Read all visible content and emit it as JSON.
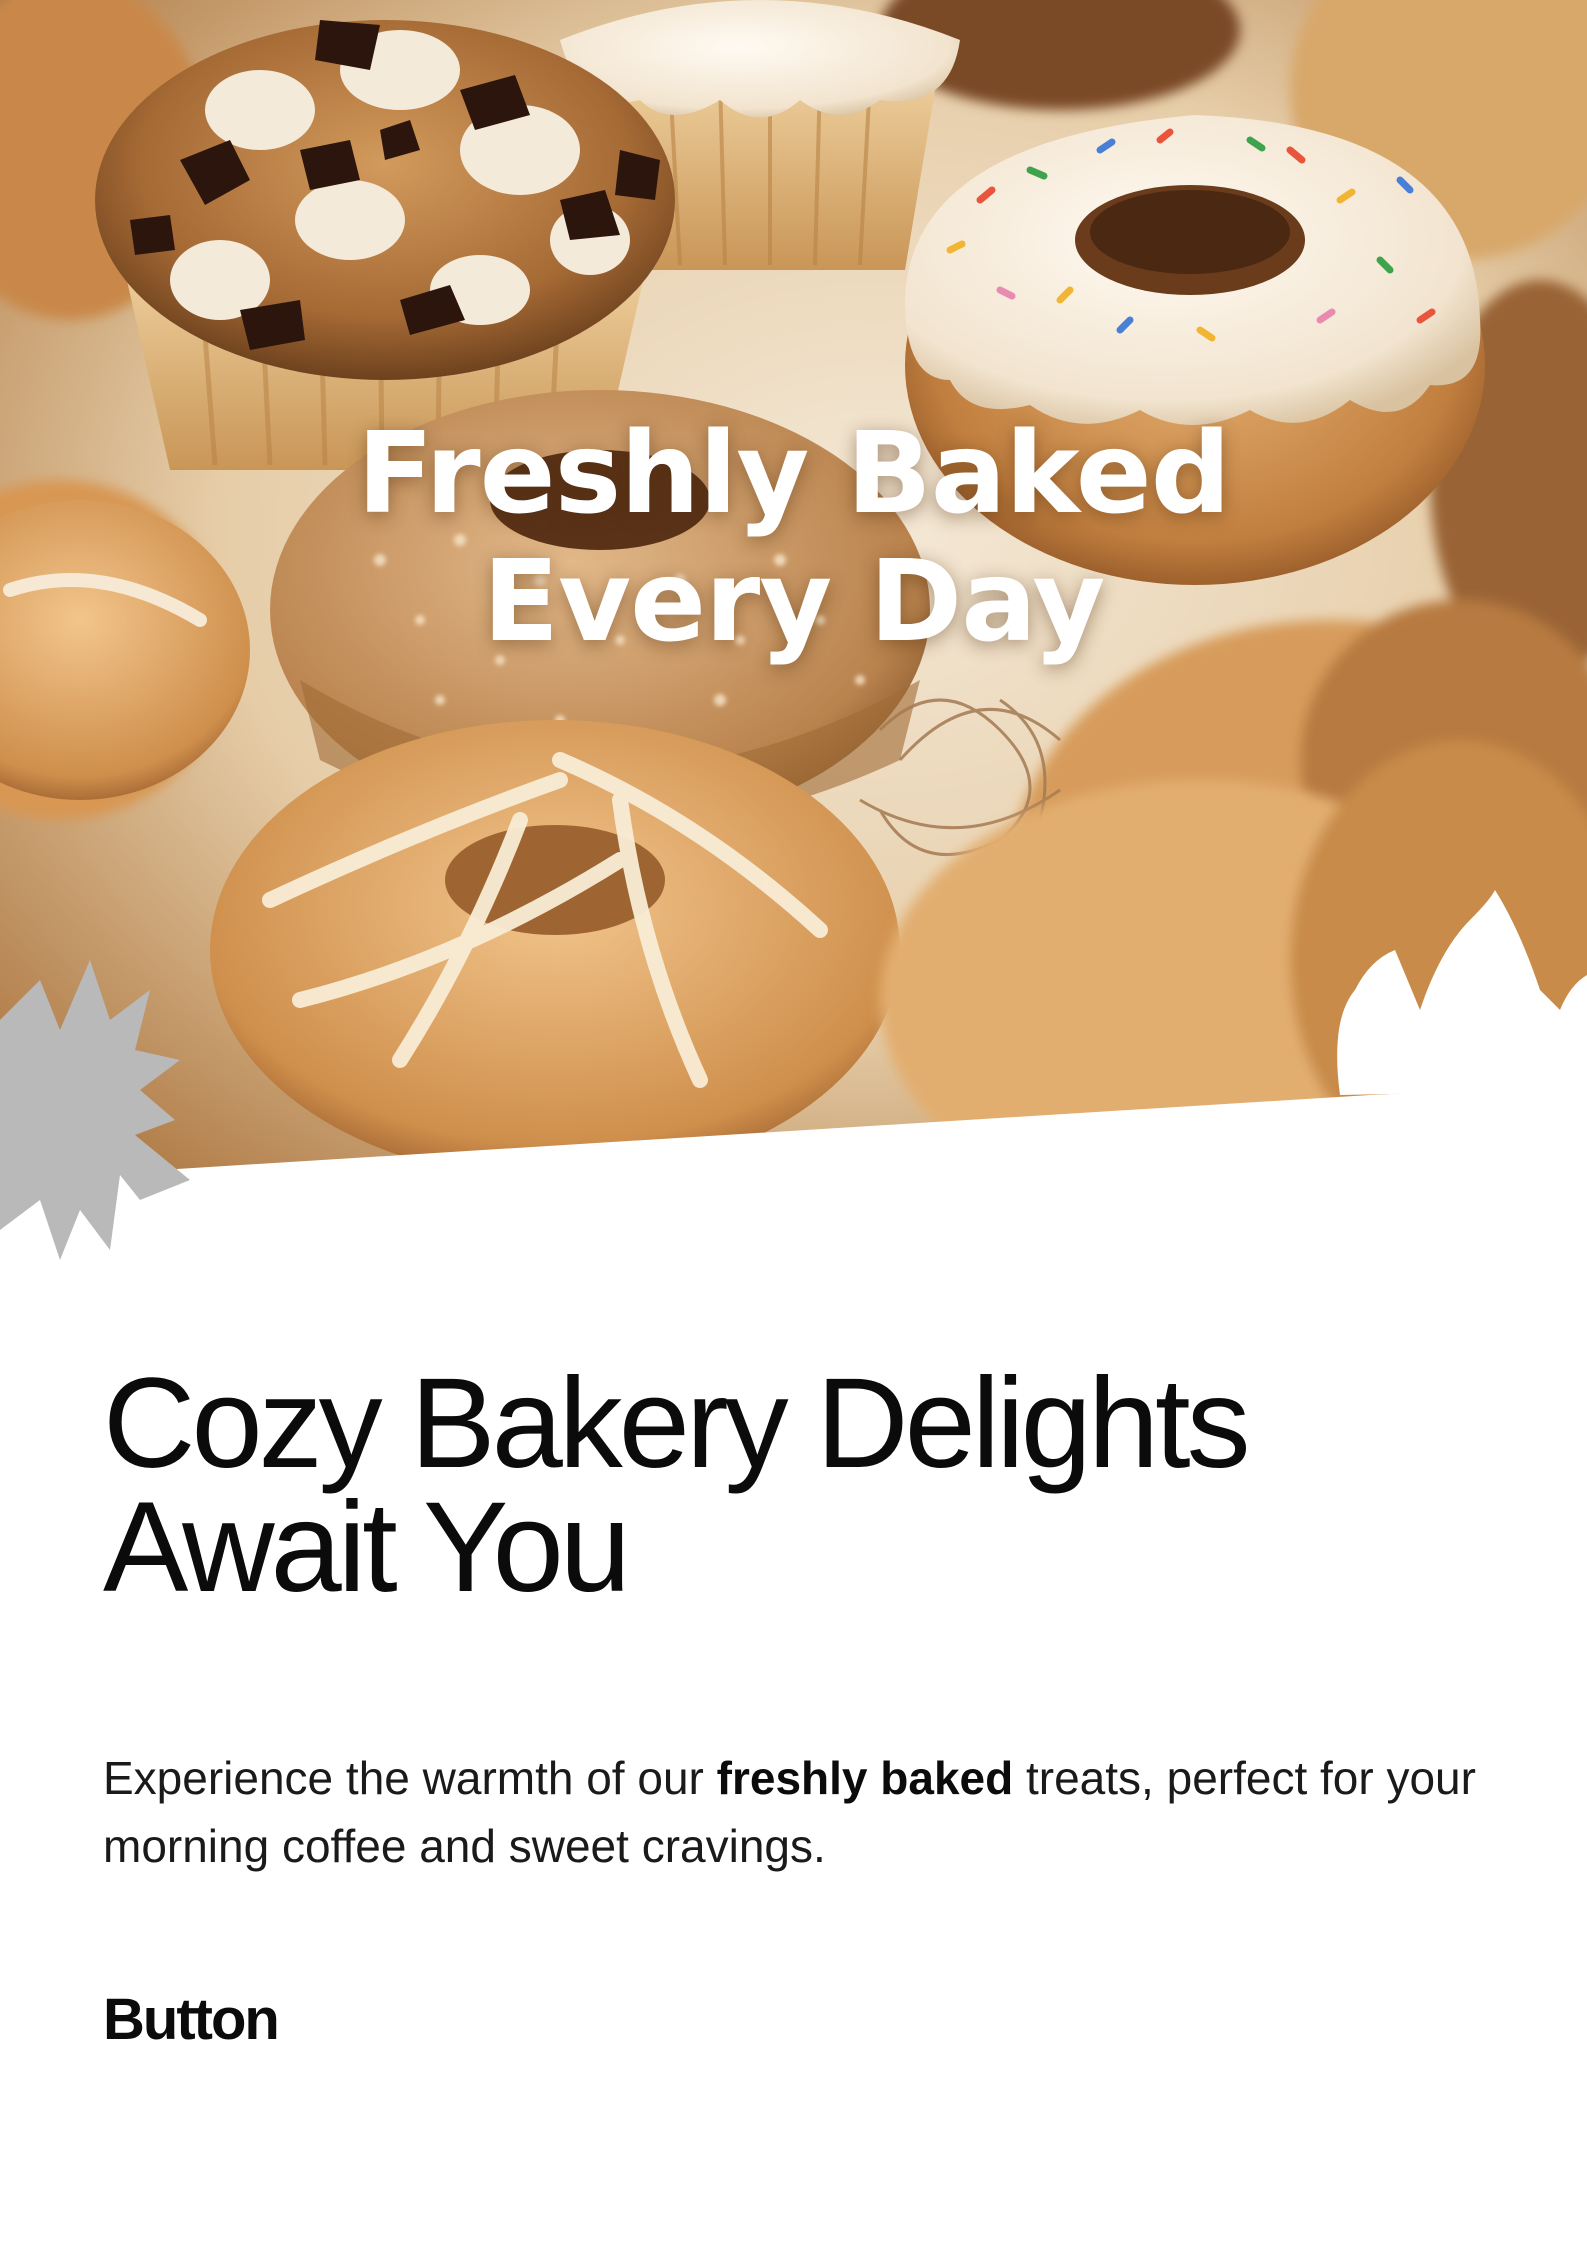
{
  "hero": {
    "headline_line1": "Freshly Baked",
    "headline_line2": "Every Day",
    "photo_icon": "bakery-photo",
    "colors": {
      "cream": "#f3e6d2",
      "golden": "#d9a25e",
      "brown": "#8a5426",
      "chocolate": "#3a2015",
      "splash_grey": "#b9b9b9"
    }
  },
  "content": {
    "title_line1": "Cozy Bakery Delights",
    "title_line2": "Await You",
    "body_prefix": "Experience the warmth of our ",
    "body_bold": "freshly baked",
    "body_suffix": " treats, perfect for your morning coffee and sweet cravings.",
    "button_label": "Button"
  }
}
